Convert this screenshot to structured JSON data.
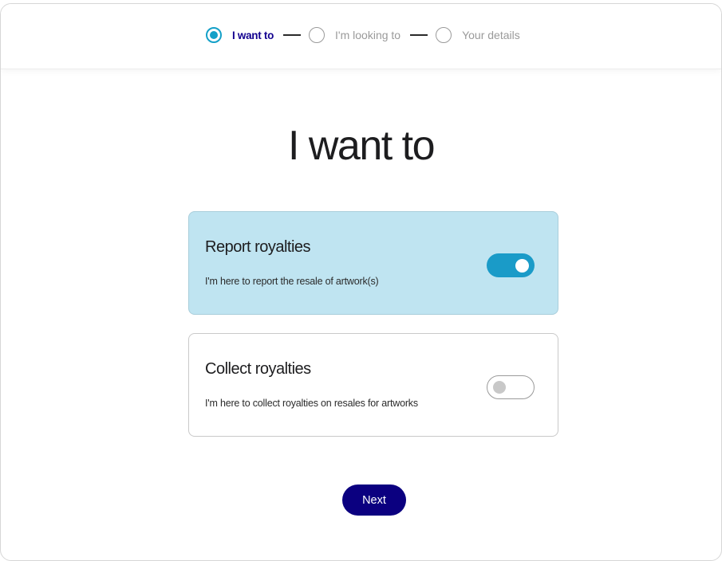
{
  "stepper": {
    "steps": [
      {
        "label": "I want to",
        "state": "active"
      },
      {
        "label": "I'm looking to",
        "state": "inactive"
      },
      {
        "label": "Your details",
        "state": "inactive"
      }
    ]
  },
  "page": {
    "title": "I want to"
  },
  "options": [
    {
      "title": "Report royalties",
      "description": "I'm here to report the resale of artwork(s)",
      "selected": true
    },
    {
      "title": "Collect royalties",
      "description": "I'm here to collect royalties on resales for artworks",
      "selected": false
    }
  ],
  "actions": {
    "next_label": "Next"
  },
  "colors": {
    "accent": "#14a0c8",
    "toggle_on": "#1a9bc8",
    "selected_card": "#bfe4f1",
    "primary_button": "#0b0080",
    "active_step_text": "#12008f"
  },
  "icons": {
    "step_active": "radio-checked-icon",
    "step_inactive": "radio-empty-icon"
  }
}
